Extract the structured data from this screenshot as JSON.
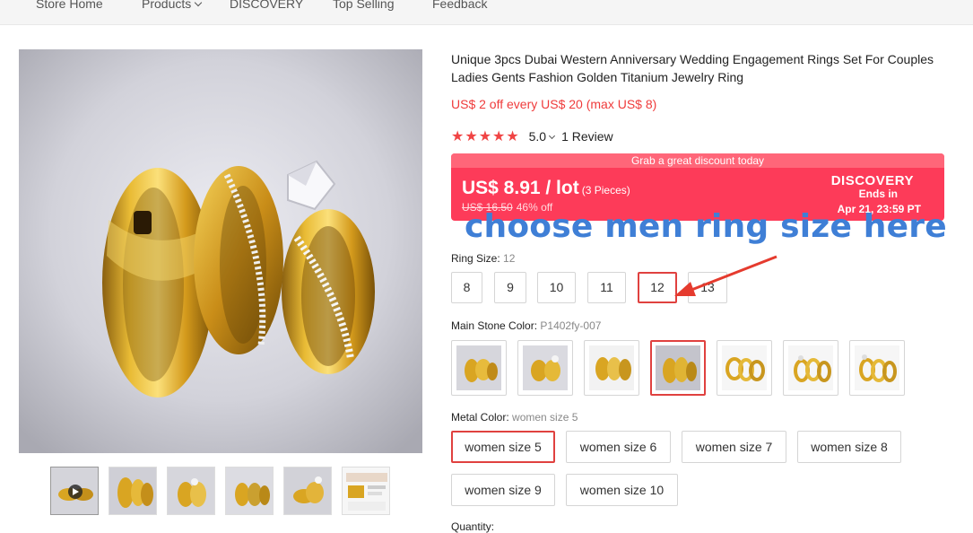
{
  "nav": {
    "items": [
      "Store Home",
      "Products",
      "DISCOVERY",
      "Top Selling",
      "Feedback"
    ]
  },
  "product": {
    "title": "Unique 3pcs Dubai Western Anniversary Wedding Engagement Rings Set For Couples Ladies Gents Fashion Golden Titanium Jewelry Ring",
    "coupon": "US$ 2 off every US$ 20 (max US$ 8)",
    "rating": {
      "stars": 5,
      "score": "5.0",
      "reviews": "1 Review"
    }
  },
  "promo": {
    "banner": "Grab a great discount today",
    "price": "US$ 8.91 / lot",
    "pieces": "(3 Pieces)",
    "original_price": "US$ 16.50",
    "discount": "46% off",
    "brand": "DISCOVERY",
    "ends_label": "Ends in",
    "ends_date": "Apr 21, 23:59 PT"
  },
  "annotation": "choose men ring size here",
  "ring_size": {
    "label": "Ring Size: ",
    "selected": "12",
    "options": [
      "8",
      "9",
      "10",
      "11",
      "12",
      "13"
    ]
  },
  "stone_color": {
    "label": "Main Stone Color: ",
    "selected": "P1402fy-007",
    "selected_index": 3
  },
  "metal_color": {
    "label": "Metal Color: ",
    "selected": "women size 5",
    "options": [
      "women size 5",
      "women size 6",
      "women size 7",
      "women size 8",
      "women size 9",
      "women size 10"
    ]
  },
  "quantity": {
    "label": "Quantity:"
  },
  "colors": {
    "accent": "#e0413f",
    "promo_bg": "#fd3b59",
    "coupon": "#ef3b3b",
    "annotation": "#3f7fd6",
    "gold": "#d9a522"
  }
}
